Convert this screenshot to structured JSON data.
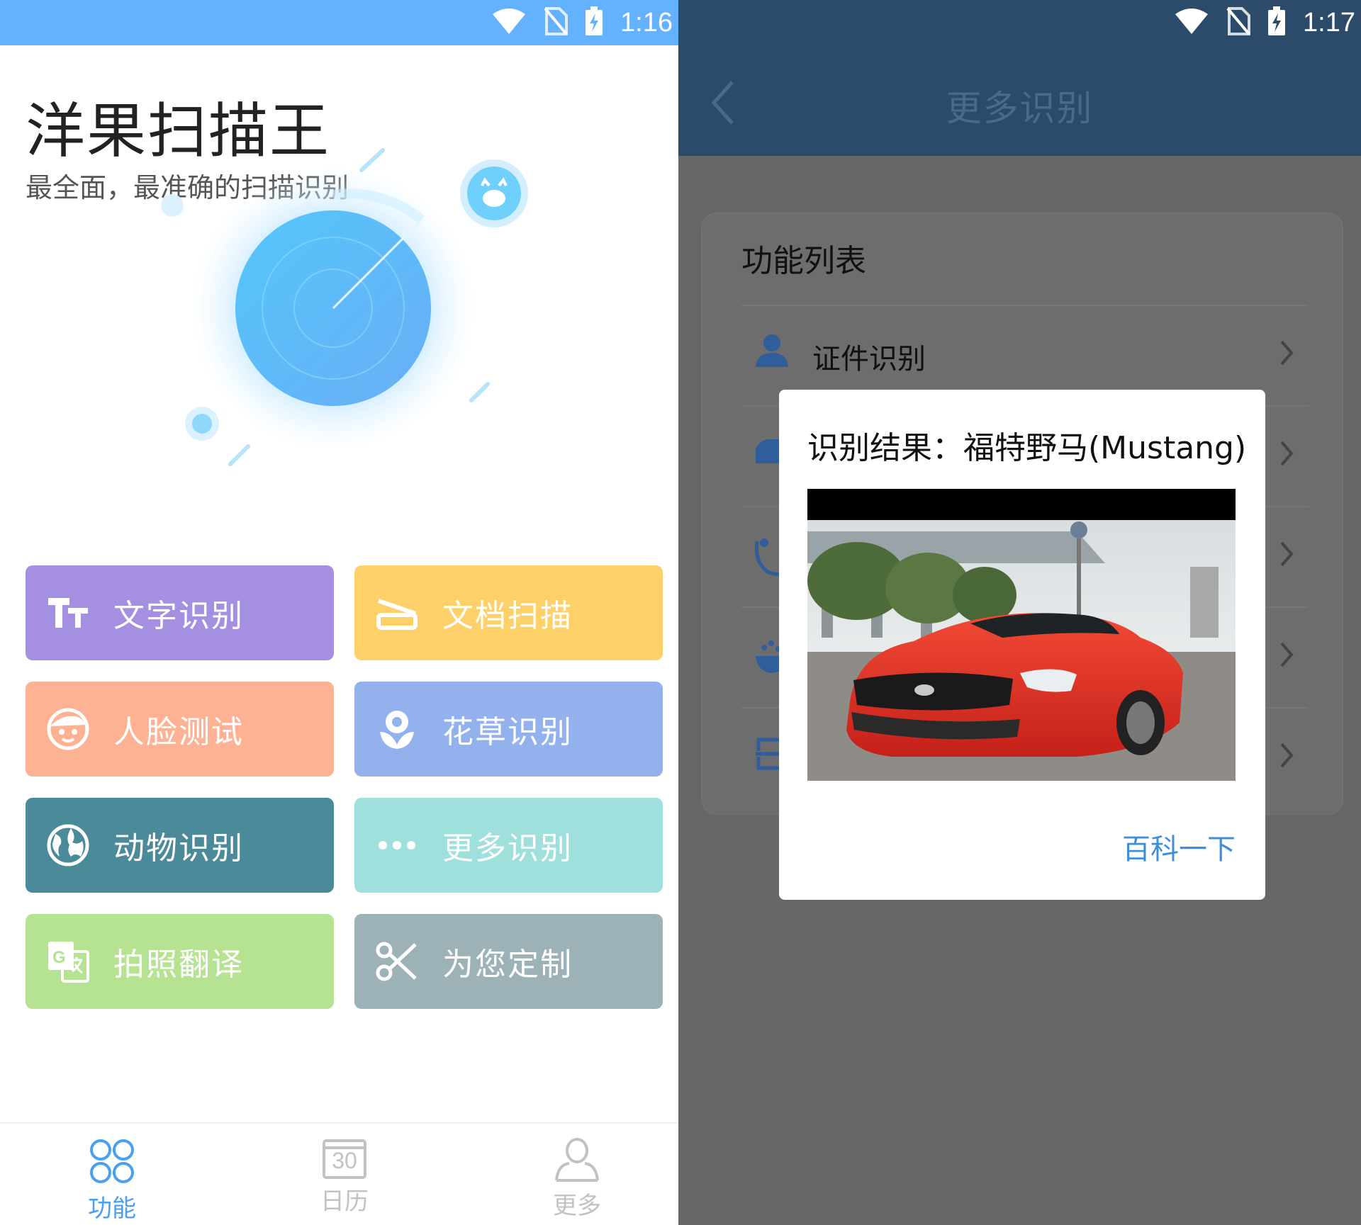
{
  "left_screen": {
    "status_bar": {
      "time": "1:16"
    },
    "app_title": "洋果扫描王",
    "app_subtitle": "最全面，最准确的扫描识别",
    "features": [
      {
        "label": "文字识别",
        "icon": "text-size-icon",
        "color": "#a58fe0"
      },
      {
        "label": "文档扫描",
        "icon": "scanner-icon",
        "color": "#fdd06a"
      },
      {
        "label": "人脸测试",
        "icon": "face-icon",
        "color": "#fdb293"
      },
      {
        "label": "花草识别",
        "icon": "flower-icon",
        "color": "#93b1ed"
      },
      {
        "label": "动物识别",
        "icon": "globe-icon",
        "color": "#4b8a99"
      },
      {
        "label": "更多识别",
        "icon": "more-dots-icon",
        "color": "#9fdfdc"
      },
      {
        "label": "拍照翻译",
        "icon": "translate-icon",
        "color": "#b5e391"
      },
      {
        "label": "为您定制",
        "icon": "scissors-icon",
        "color": "#9db2b7"
      }
    ],
    "bottom_nav": [
      {
        "label": "功能",
        "icon": "grid-icon",
        "active": true
      },
      {
        "label": "日历",
        "icon": "calendar-icon",
        "calendar_number": "30",
        "active": false
      },
      {
        "label": "更多",
        "icon": "user-icon",
        "active": false
      }
    ],
    "colors": {
      "status_bar": "#64b1ff",
      "nav_active": "#4aa0ee",
      "nav_inactive": "#c2c2c2"
    }
  },
  "right_screen": {
    "status_bar": {
      "time": "1:17"
    },
    "header_title": "更多识别",
    "list_title": "功能列表",
    "list_items": [
      {
        "label": "证件识别",
        "icon": "person-icon"
      },
      {
        "label": "",
        "icon": "car-icon"
      },
      {
        "label": "",
        "icon": "plant-icon"
      },
      {
        "label": "",
        "icon": "food-icon"
      },
      {
        "label": "",
        "icon": "card-icon"
      }
    ],
    "dialog": {
      "title": "识别结果：福特野马(Mustang)",
      "image_alt": "red-mustang-photo",
      "link_label": "百科一下"
    },
    "colors": {
      "header": "#2c4a6a",
      "overlay": "#676767",
      "link": "#3d8fd9"
    }
  }
}
